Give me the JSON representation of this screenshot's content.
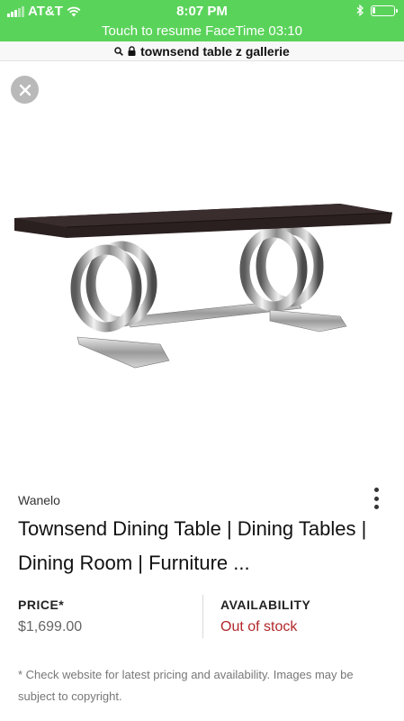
{
  "status_bar": {
    "carrier": "AT&T",
    "time": "8:07 PM"
  },
  "facetime_banner": "Touch to resume FaceTime 03:10",
  "url_bar": {
    "text": "townsend table z gallerie"
  },
  "product": {
    "source": "Wanelo",
    "title": "Townsend Dining Table | Dining Tables | Dining Room | Furniture ...",
    "price_label": "PRICE*",
    "price": "$1,699.00",
    "availability_label": "AVAILABILITY",
    "availability": "Out of stock"
  },
  "disclaimer": "* Check website for latest pricing and availability. Images may be subject to copyright.",
  "colors": {
    "status_green": "#5ad35a",
    "out_of_stock_red": "#b3262a"
  },
  "icons": [
    "signal-icon",
    "wifi-icon",
    "bluetooth-icon",
    "battery-icon",
    "search-icon",
    "lock-icon",
    "close-icon",
    "more-options-icon"
  ]
}
